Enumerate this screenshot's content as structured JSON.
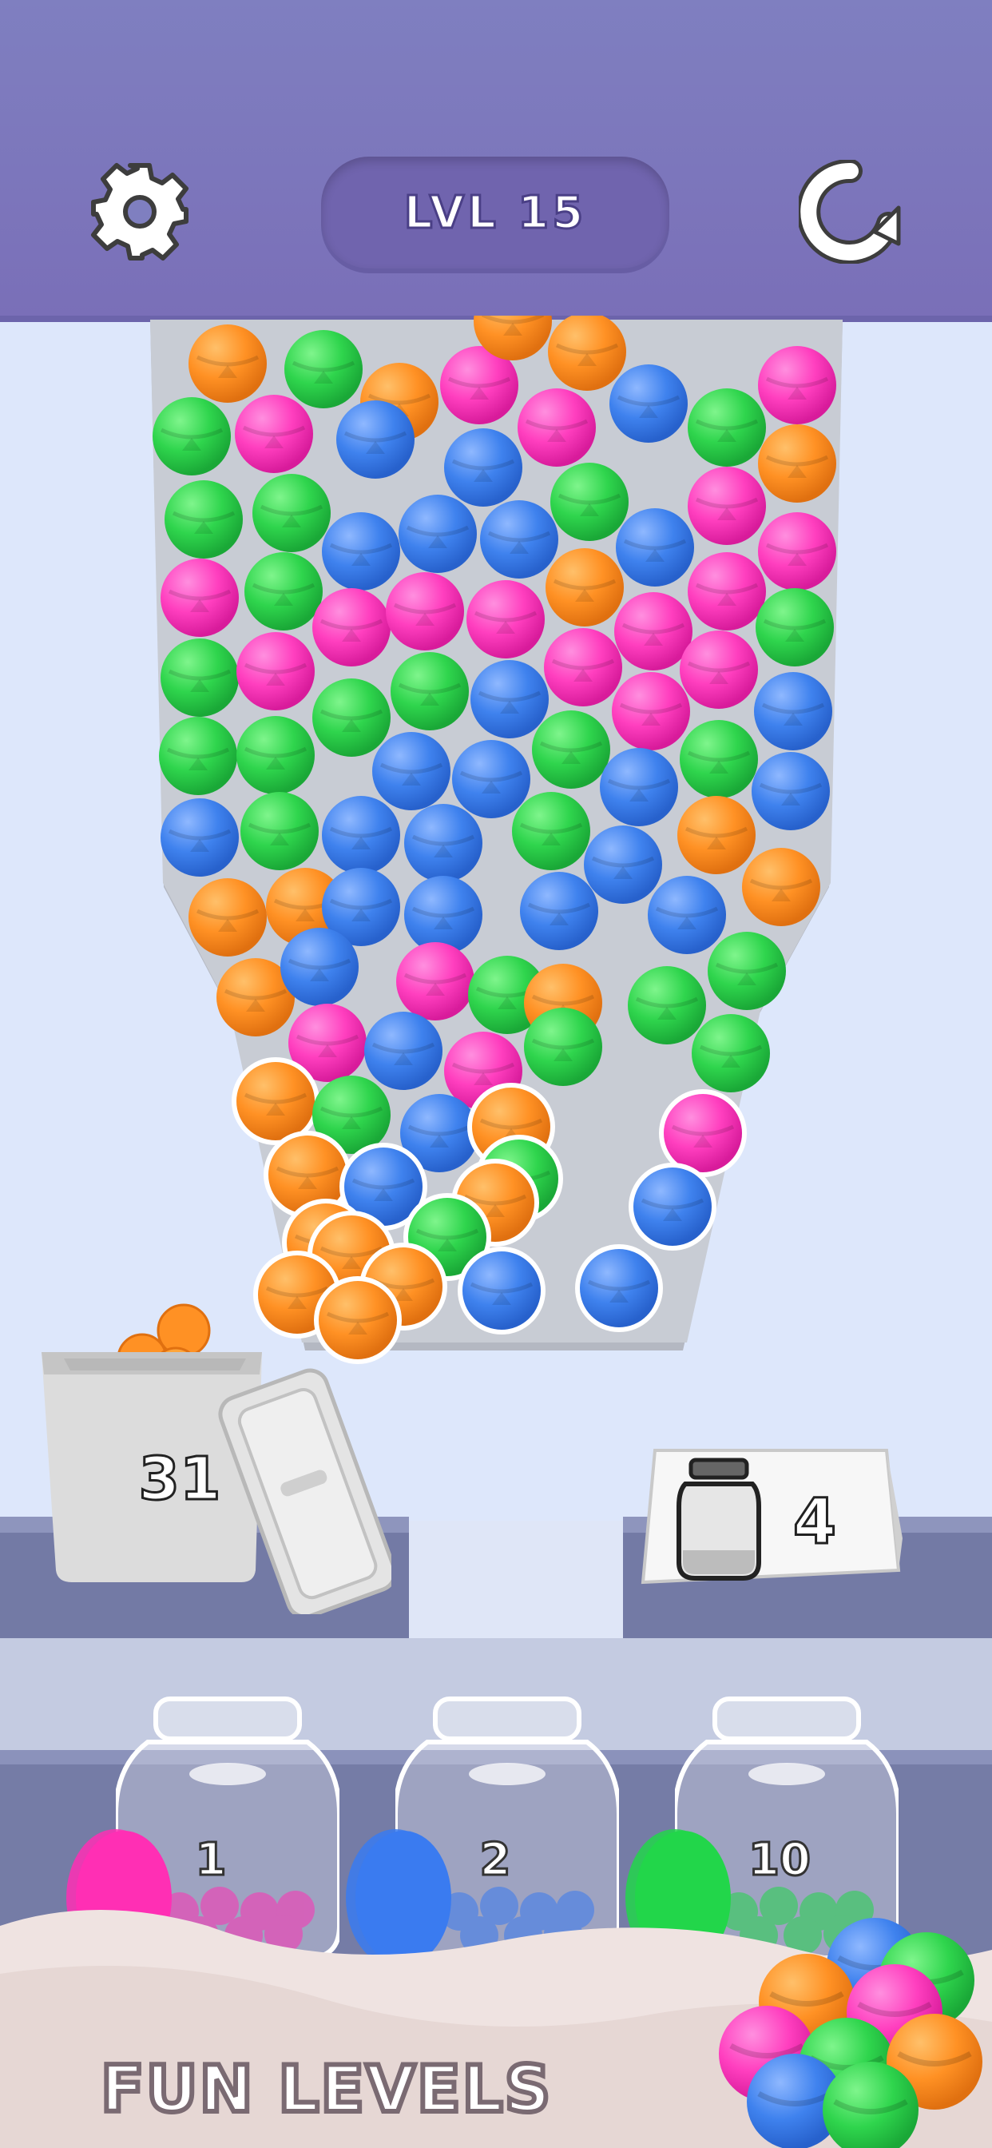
{
  "header": {
    "level_label": "LVL 15",
    "settings_icon": "gear-icon",
    "restart_icon": "restart-icon",
    "bar_color": "#7f7fc0"
  },
  "trash": {
    "count": "31",
    "icon": "trash-bin-icon"
  },
  "jar_sign": {
    "count": "4",
    "icon": "jar-icon"
  },
  "jars": [
    {
      "color": "#ff2fb4",
      "count": "1"
    },
    {
      "color": "#3a7bf0",
      "count": "2"
    },
    {
      "color": "#22d64a",
      "count": "10"
    }
  ],
  "footer": {
    "title": "FUN LEVELS"
  },
  "colors": {
    "orange": "#ff9124",
    "green": "#2fd54d",
    "pink": "#ff3fbf",
    "blue": "#3f82ee"
  }
}
